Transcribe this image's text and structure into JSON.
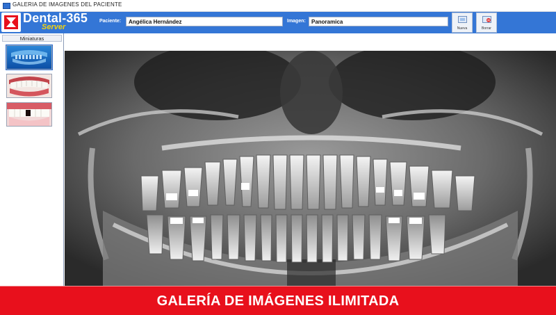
{
  "window": {
    "title": "GALERIA DE IMAGENES DEL PACIENTE"
  },
  "logo": {
    "brand": "Dental-365",
    "edition": "Server"
  },
  "patient": {
    "label": "Paciente:",
    "value": "Angélica Hernández"
  },
  "image": {
    "label": "Imagen:",
    "value": "Panoramica"
  },
  "toolbar": {
    "new_label": "Nueva",
    "delete_label": "Borrar"
  },
  "sidebar": {
    "header": "Miniaturas",
    "thumbnails": [
      {
        "name": "panoramic-xray-thumb",
        "selected": true
      },
      {
        "name": "smile-photo-thumb",
        "selected": false
      },
      {
        "name": "missing-tooth-photo-thumb",
        "selected": false
      }
    ]
  },
  "banner": {
    "text": "GALERÍA DE IMÁGENES ILIMITADA"
  },
  "colors": {
    "toolbar": "#3476d6",
    "banner": "#e8101c",
    "edition": "#f3d20e"
  }
}
